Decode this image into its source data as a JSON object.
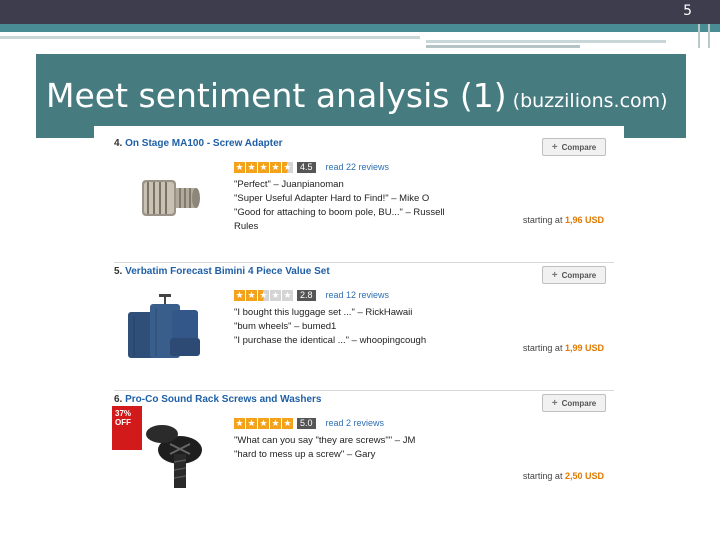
{
  "slide": {
    "number": "5",
    "title": "Meet sentiment analysis (1)",
    "subtitle": "(buzzilions.com)"
  },
  "colors": {
    "title_band": "#467b80",
    "top_bar": "#3d3d4d",
    "link_blue": "#1f5fa6",
    "star_orange": "#f3a21b",
    "price_orange": "#e07a00",
    "discount_red": "#d21a1a"
  },
  "products": [
    {
      "number": "4.",
      "name": "On Stage MA100 - Screw Adapter",
      "stars": [
        1,
        1,
        1,
        1,
        0.5
      ],
      "score": "4.5",
      "reviews": "read 22 reviews",
      "quotes": [
        "\"Perfect\" – Juanpianoman",
        "\"Super Useful Adapter Hard to Find!\" – Mike O",
        "\"Good for attaching to boom pole, BU...\" – Russell Rules"
      ],
      "price_label": "starting at",
      "price": "1,96 USD",
      "compare_label": "Compare",
      "image": "screw-adapter"
    },
    {
      "number": "5.",
      "name": "Verbatim Forecast Bimini 4 Piece Value Set",
      "stars": [
        1,
        1,
        0.5,
        0,
        0
      ],
      "score": "2.8",
      "reviews": "read 12 reviews",
      "quotes": [
        "\"I bought this luggage set ...\" – RickHawaii",
        "\"bum wheels\" – bumed1",
        "\"I purchase the identical ...\" – whoopingcough"
      ],
      "price_label": "starting at",
      "price": "1,99 USD",
      "compare_label": "Compare",
      "image": "luggage-set"
    },
    {
      "number": "6.",
      "name": "Pro-Co Sound Rack Screws and Washers",
      "stars": [
        1,
        1,
        1,
        1,
        1
      ],
      "score": "5.0",
      "reviews": "read 2 reviews",
      "quotes": [
        "\"What can you say \"they are screws\"\" – JM",
        "\"hard to mess up a screw\" – Gary"
      ],
      "price_label": "starting at",
      "price": "2,50 USD",
      "compare_label": "Compare",
      "image": "rack-screws",
      "badge": [
        "37%",
        "OFF"
      ]
    }
  ]
}
